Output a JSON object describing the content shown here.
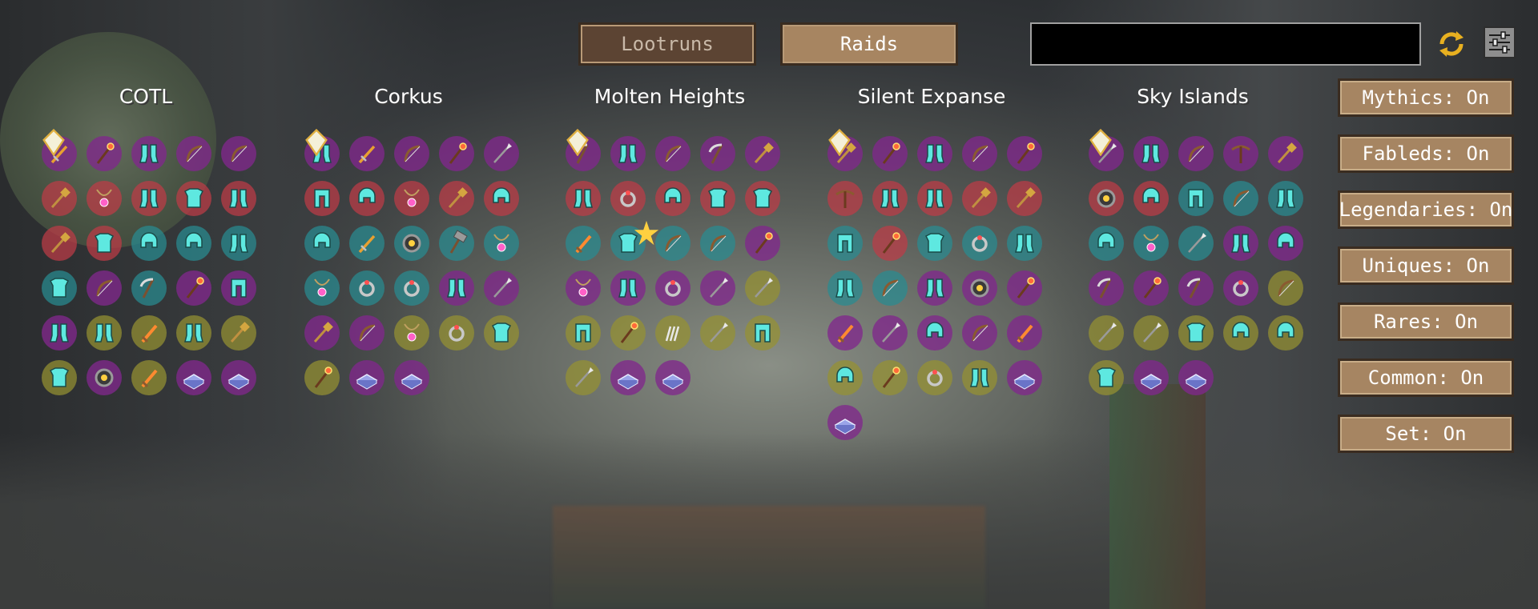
{
  "tabs": [
    {
      "label": "Lootruns",
      "active": false
    },
    {
      "label": "Raids",
      "active": true
    }
  ],
  "search": {
    "value": "",
    "placeholder": ""
  },
  "icons": {
    "refresh": "refresh-icon",
    "filter": "filter-settings-icon"
  },
  "tier_colors": {
    "mythic": "#7a2b86",
    "fabled": "#b8484f",
    "legendary": "#2f8a8c",
    "unique": "#a8a040",
    "set": "#3d9b3d"
  },
  "columns": [
    {
      "title": "COTL",
      "items": [
        {
          "type": "dagger",
          "tier": "mythic",
          "gem": true
        },
        {
          "type": "wand",
          "tier": "mythic"
        },
        {
          "type": "boots",
          "tier": "mythic"
        },
        {
          "type": "bow",
          "tier": "mythic"
        },
        {
          "type": "bow",
          "tier": "mythic"
        },
        {
          "type": "relik",
          "tier": "fabled"
        },
        {
          "type": "necklace",
          "tier": "fabled"
        },
        {
          "type": "boots",
          "tier": "fabled"
        },
        {
          "type": "chestplate",
          "tier": "fabled"
        },
        {
          "type": "boots",
          "tier": "fabled"
        },
        {
          "type": "relik",
          "tier": "fabled"
        },
        {
          "type": "chestplate",
          "tier": "fabled"
        },
        {
          "type": "helmet",
          "tier": "legendary"
        },
        {
          "type": "helmet",
          "tier": "legendary"
        },
        {
          "type": "boots",
          "tier": "legendary"
        },
        {
          "type": "chestplate",
          "tier": "legendary"
        },
        {
          "type": "bow",
          "tier": "mythic"
        },
        {
          "type": "scythe",
          "tier": "legendary"
        },
        {
          "type": "wand",
          "tier": "mythic"
        },
        {
          "type": "leggings",
          "tier": "mythic"
        },
        {
          "type": "boots",
          "tier": "mythic"
        },
        {
          "type": "boots",
          "tier": "unique"
        },
        {
          "type": "sword",
          "tier": "unique"
        },
        {
          "type": "boots",
          "tier": "unique"
        },
        {
          "type": "relik",
          "tier": "unique"
        },
        {
          "type": "chestplate",
          "tier": "unique"
        },
        {
          "type": "bracelet",
          "tier": "mythic"
        },
        {
          "type": "sword",
          "tier": "unique"
        },
        {
          "type": "tome",
          "tier": "mythic"
        },
        {
          "type": "tome",
          "tier": "mythic"
        }
      ]
    },
    {
      "title": "Corkus",
      "items": [
        {
          "type": "boots",
          "tier": "mythic",
          "gem": true
        },
        {
          "type": "dagger",
          "tier": "mythic"
        },
        {
          "type": "bow",
          "tier": "mythic"
        },
        {
          "type": "wand",
          "tier": "mythic"
        },
        {
          "type": "spear",
          "tier": "mythic"
        },
        {
          "type": "leggings",
          "tier": "fabled"
        },
        {
          "type": "helmet",
          "tier": "fabled"
        },
        {
          "type": "necklace",
          "tier": "fabled"
        },
        {
          "type": "relik",
          "tier": "fabled"
        },
        {
          "type": "helmet",
          "tier": "fabled"
        },
        {
          "type": "helmet",
          "tier": "legendary"
        },
        {
          "type": "dagger",
          "tier": "legendary"
        },
        {
          "type": "bracelet",
          "tier": "legendary"
        },
        {
          "type": "hammer",
          "tier": "legendary"
        },
        {
          "type": "necklace",
          "tier": "legendary"
        },
        {
          "type": "necklace",
          "tier": "legendary"
        },
        {
          "type": "ring",
          "tier": "legendary"
        },
        {
          "type": "ring",
          "tier": "legendary"
        },
        {
          "type": "boots",
          "tier": "mythic"
        },
        {
          "type": "spear",
          "tier": "mythic"
        },
        {
          "type": "relik",
          "tier": "mythic"
        },
        {
          "type": "bow",
          "tier": "mythic"
        },
        {
          "type": "necklace",
          "tier": "unique"
        },
        {
          "type": "ring",
          "tier": "unique"
        },
        {
          "type": "chestplate",
          "tier": "unique"
        },
        {
          "type": "wand",
          "tier": "unique"
        },
        {
          "type": "tome",
          "tier": "mythic"
        },
        {
          "type": "tome",
          "tier": "mythic"
        }
      ]
    },
    {
      "title": "Molten Heights",
      "items": [
        {
          "type": "scythe",
          "tier": "mythic",
          "gem": true
        },
        {
          "type": "boots",
          "tier": "mythic"
        },
        {
          "type": "bow",
          "tier": "mythic"
        },
        {
          "type": "scythe",
          "tier": "mythic"
        },
        {
          "type": "relik",
          "tier": "mythic"
        },
        {
          "type": "boots",
          "tier": "fabled"
        },
        {
          "type": "ring",
          "tier": "fabled"
        },
        {
          "type": "helmet",
          "tier": "fabled"
        },
        {
          "type": "chestplate",
          "tier": "fabled"
        },
        {
          "type": "chestplate",
          "tier": "fabled"
        },
        {
          "type": "sword",
          "tier": "legendary"
        },
        {
          "type": "chestplate",
          "tier": "legendary",
          "star": true
        },
        {
          "type": "bow",
          "tier": "legendary"
        },
        {
          "type": "bow",
          "tier": "legendary"
        },
        {
          "type": "wand",
          "tier": "mythic"
        },
        {
          "type": "necklace",
          "tier": "mythic"
        },
        {
          "type": "boots",
          "tier": "mythic"
        },
        {
          "type": "ring",
          "tier": "mythic"
        },
        {
          "type": "spear",
          "tier": "mythic"
        },
        {
          "type": "spear",
          "tier": "unique"
        },
        {
          "type": "leggings",
          "tier": "unique"
        },
        {
          "type": "wand",
          "tier": "unique"
        },
        {
          "type": "claw",
          "tier": "unique"
        },
        {
          "type": "spear",
          "tier": "unique"
        },
        {
          "type": "leggings",
          "tier": "unique"
        },
        {
          "type": "spear",
          "tier": "unique"
        },
        {
          "type": "tome",
          "tier": "mythic"
        },
        {
          "type": "tome",
          "tier": "mythic"
        }
      ]
    },
    {
      "title": "Silent Expanse",
      "items": [
        {
          "type": "relik",
          "tier": "mythic",
          "gem": true
        },
        {
          "type": "wand",
          "tier": "mythic"
        },
        {
          "type": "boots",
          "tier": "mythic"
        },
        {
          "type": "bow",
          "tier": "mythic"
        },
        {
          "type": "wand",
          "tier": "mythic"
        },
        {
          "type": "crossbow",
          "tier": "fabled"
        },
        {
          "type": "boots",
          "tier": "fabled"
        },
        {
          "type": "boots",
          "tier": "fabled"
        },
        {
          "type": "relik",
          "tier": "fabled"
        },
        {
          "type": "relik",
          "tier": "fabled"
        },
        {
          "type": "leggings",
          "tier": "legendary"
        },
        {
          "type": "wand",
          "tier": "fabled"
        },
        {
          "type": "chestplate",
          "tier": "legendary"
        },
        {
          "type": "ring",
          "tier": "legendary"
        },
        {
          "type": "boots",
          "tier": "legendary"
        },
        {
          "type": "boots",
          "tier": "legendary"
        },
        {
          "type": "bow",
          "tier": "legendary"
        },
        {
          "type": "boots",
          "tier": "mythic"
        },
        {
          "type": "bracelet",
          "tier": "mythic"
        },
        {
          "type": "wand",
          "tier": "mythic"
        },
        {
          "type": "sword",
          "tier": "mythic"
        },
        {
          "type": "spear",
          "tier": "mythic"
        },
        {
          "type": "helmet",
          "tier": "mythic"
        },
        {
          "type": "bow",
          "tier": "mythic"
        },
        {
          "type": "sword",
          "tier": "mythic"
        },
        {
          "type": "helmet",
          "tier": "unique"
        },
        {
          "type": "wand",
          "tier": "unique"
        },
        {
          "type": "ring",
          "tier": "unique"
        },
        {
          "type": "boots",
          "tier": "unique"
        },
        {
          "type": "tome",
          "tier": "mythic"
        },
        {
          "type": "tome",
          "tier": "mythic"
        }
      ]
    },
    {
      "title": "Sky Islands",
      "items": [
        {
          "type": "spear",
          "tier": "mythic",
          "gem": true
        },
        {
          "type": "boots",
          "tier": "mythic"
        },
        {
          "type": "bow",
          "tier": "mythic"
        },
        {
          "type": "crossbow",
          "tier": "mythic"
        },
        {
          "type": "relik",
          "tier": "mythic"
        },
        {
          "type": "bracelet",
          "tier": "fabled"
        },
        {
          "type": "helmet",
          "tier": "fabled"
        },
        {
          "type": "leggings",
          "tier": "legendary"
        },
        {
          "type": "bow",
          "tier": "legendary"
        },
        {
          "type": "boots",
          "tier": "legendary"
        },
        {
          "type": "helmet",
          "tier": "legendary"
        },
        {
          "type": "necklace",
          "tier": "legendary"
        },
        {
          "type": "spear",
          "tier": "legendary"
        },
        {
          "type": "boots",
          "tier": "mythic"
        },
        {
          "type": "helmet",
          "tier": "mythic"
        },
        {
          "type": "scythe",
          "tier": "mythic"
        },
        {
          "type": "wand",
          "tier": "mythic"
        },
        {
          "type": "scythe",
          "tier": "mythic"
        },
        {
          "type": "ring",
          "tier": "mythic"
        },
        {
          "type": "bow",
          "tier": "unique"
        },
        {
          "type": "spear",
          "tier": "unique"
        },
        {
          "type": "spear",
          "tier": "unique"
        },
        {
          "type": "chestplate",
          "tier": "unique"
        },
        {
          "type": "helmet",
          "tier": "unique"
        },
        {
          "type": "helmet",
          "tier": "unique"
        },
        {
          "type": "chestplate",
          "tier": "unique"
        },
        {
          "type": "tome",
          "tier": "mythic"
        },
        {
          "type": "tome",
          "tier": "mythic"
        }
      ]
    }
  ],
  "filters": [
    {
      "label": "Mythics: On"
    },
    {
      "label": "Fableds: On"
    },
    {
      "label": "Legendaries: On"
    },
    {
      "label": "Uniques: On"
    },
    {
      "label": "Rares: On"
    },
    {
      "label": "Common: On"
    },
    {
      "label": "Set: On"
    }
  ]
}
